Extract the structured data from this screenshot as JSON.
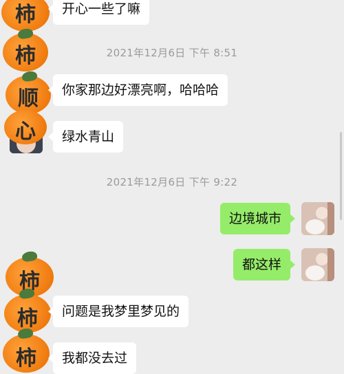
{
  "colors": {
    "background": "#ededed",
    "bubble_incoming": "#ffffff",
    "bubble_outgoing": "#95ec69",
    "timestamp_text": "#9a9a9a"
  },
  "timestamps": [
    "2021年12月6日 下午 8:51",
    "2021年12月6日 下午 9:22"
  ],
  "messages": [
    {
      "side": "left",
      "text": "开心一些了嘛"
    },
    {
      "side": "left",
      "text": "你家那边好漂亮啊，哈哈哈"
    },
    {
      "side": "left",
      "text": "绿水青山"
    },
    {
      "side": "right",
      "text": "边境城市"
    },
    {
      "side": "right",
      "text": "都这样"
    },
    {
      "side": "left",
      "text": "问题是我梦里梦见的"
    },
    {
      "side": "left",
      "text": "我都没去过"
    }
  ],
  "sticker_glyphs": [
    "柿",
    "柿",
    "顺",
    "心",
    "柿",
    "柿",
    "柿"
  ],
  "avatars": {
    "contact": "contact-avatar-icon",
    "self": "self-avatar-photo-icon"
  }
}
